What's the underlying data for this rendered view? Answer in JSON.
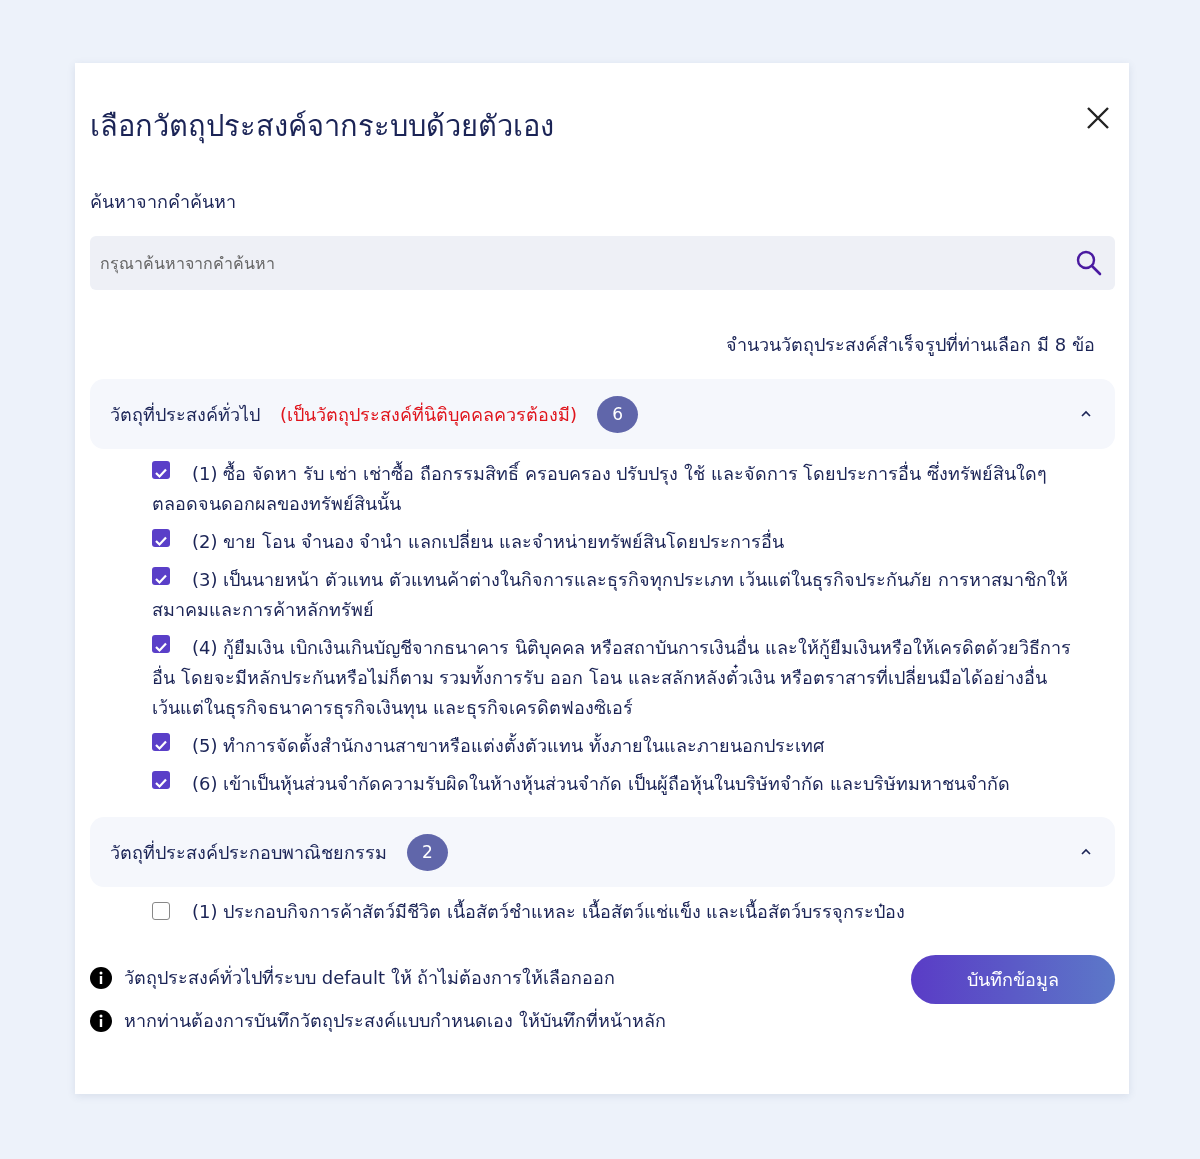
{
  "dialog": {
    "title": "เลือกวัตถุประสงค์จากระบบด้วยตัวเอง"
  },
  "search": {
    "label": "ค้นหาจากคำค้นหา",
    "placeholder": "กรุณาค้นหาจากคำค้นหา"
  },
  "summary": "จำนวนวัตถุประสงค์สำเร็จรูปที่ท่านเลือก มี 8 ข้อ",
  "sections": [
    {
      "title": "วัตถุที่ประสงค์ทั่วไป",
      "note": "(เป็นวัตถุประสงค์ที่นิติบุคคลควรต้องมี)",
      "count": "6",
      "expanded": true,
      "items": [
        {
          "text": "(1) ซื้อ จัดหา รับ เช่า เช่าซื้อ ถือกรรมสิทธิ์ ครอบครอง ปรับปรุง ใช้ และจัดการ โดยประการอื่น ซึ่งทรัพย์สินใดๆ ตลอดจนดอกผลของทรัพย์สินนั้น",
          "checked": true
        },
        {
          "text": "(2) ขาย โอน จำนอง จำนำ แลกเปลี่ยน และจำหน่ายทรัพย์สินโดยประการอื่น",
          "checked": true
        },
        {
          "text": "(3) เป็นนายหน้า ตัวแทน ตัวแทนค้าต่างในกิจการและธุรกิจทุกประเภท เว้นแต่ในธุรกิจประกันภัย การหาสมาชิกให้สมาคมและการค้าหลักทรัพย์",
          "checked": true
        },
        {
          "text": "(4) กู้ยืมเงิน เบิกเงินเกินบัญชีจากธนาคาร นิติบุคคล หรือสถาบันการเงินอื่น และให้กู้ยืมเงินหรือให้เครดิตด้วยวิธีการอื่น โดยจะมีหลักประกันหรือไม่ก็ตาม รวมทั้งการรับ ออก โอน และสลักหลังตั๋วเงิน หรือตราสารที่เปลี่ยนมือได้อย่างอื่น เว้นแต่ในธุรกิจธนาคารธุรกิจเงินทุน และธุรกิจเครดิตฟองซิเอร์",
          "checked": true
        },
        {
          "text": "(5) ทำการจัดตั้งสำนักงานสาขาหรือแต่งตั้งตัวแทน ทั้งภายในและภายนอกประเทศ",
          "checked": true
        },
        {
          "text": "(6) เข้าเป็นหุ้นส่วนจำกัดความรับผิดในห้างหุ้นส่วนจำกัด เป็นผู้ถือหุ้นในบริษัทจำกัด และบริษัทมหาชนจำกัด",
          "checked": true
        }
      ]
    },
    {
      "title": "วัตถุที่ประสงค์ประกอบพาณิชยกรรม",
      "count": "2",
      "expanded": true,
      "items": [
        {
          "text": "(1) ประกอบกิจการค้าสัตว์มีชีวิต เนื้อสัตว์ชำแหละ เนื้อสัตว์แช่แข็ง และเนื้อสัตว์บรรจุกระป๋อง",
          "checked": false
        }
      ]
    }
  ],
  "notes": [
    "วัตถุประสงค์ทั่วไปที่ระบบ default ให้ ถ้าไม่ต้องการให้เลือกออก",
    "หากท่านต้องการบันทึกวัตถุประสงค์แบบกำหนดเอง ให้บันทึกที่หน้าหลัก"
  ],
  "save_button": "บันทึกข้อมูล"
}
